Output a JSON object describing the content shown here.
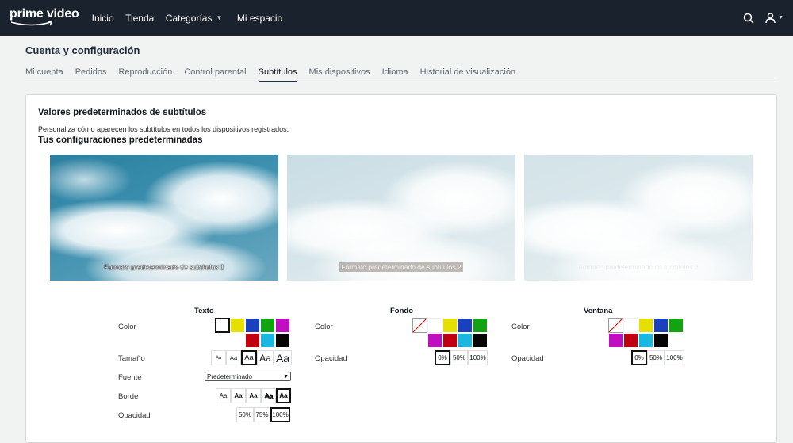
{
  "header": {
    "logo": "prime video",
    "nav": [
      "Inicio",
      "Tienda",
      "Categorías",
      "Mi espacio"
    ],
    "icons": [
      "search-icon",
      "user-icon"
    ]
  },
  "page_title": "Cuenta y configuración",
  "tabs": [
    "Mi cuenta",
    "Pedidos",
    "Reproducción",
    "Control parental",
    "Subtítulos",
    "Mis dispositivos",
    "Idioma",
    "Historial de visualización"
  ],
  "active_tab": "Subtítulos",
  "card": {
    "title": "Valores predeterminados de subtítulos",
    "description": "Personaliza cómo aparecen los subtítulos en todos los dispositivos registrados.",
    "subtitle": "Tus configuraciones predeterminadas",
    "previews": [
      "Formato predeterminado de subtítulos 1",
      "Formato predeterminado de subtítulos 2",
      "Formato predeterminado de subtítulos 3"
    ]
  },
  "texto": {
    "title": "Texto",
    "labels": {
      "color": "Color",
      "size": "Tamaño",
      "font": "Fuente",
      "border": "Borde",
      "opacity": "Opacidad"
    },
    "sizes": [
      "Aa",
      "Aa",
      "Aa",
      "Aa",
      "Aa"
    ],
    "font_value": "Predeterminado",
    "borders": [
      "Aa",
      "Aa",
      "Aa",
      "Aa",
      "Aa"
    ],
    "opacities": [
      "50%",
      "75%",
      "100%"
    ]
  },
  "fondo": {
    "title": "Fondo",
    "labels": {
      "color": "Color",
      "opacity": "Opacidad"
    },
    "opacities": [
      "0%",
      "50%",
      "100%"
    ]
  },
  "ventana": {
    "title": "Ventana",
    "labels": {
      "color": "Color",
      "opacity": "Opacidad"
    },
    "opacities": [
      "0%",
      "50%",
      "100%"
    ]
  },
  "colors": {
    "white": "#ffffff",
    "yellow": "#e5e000",
    "blue": "#1a3fbf",
    "green": "#12a312",
    "magenta": "#c00fc0",
    "red": "#c00010",
    "cyan": "#1ab8e0",
    "black": "#050505",
    "header_bg": "#1a232d"
  }
}
